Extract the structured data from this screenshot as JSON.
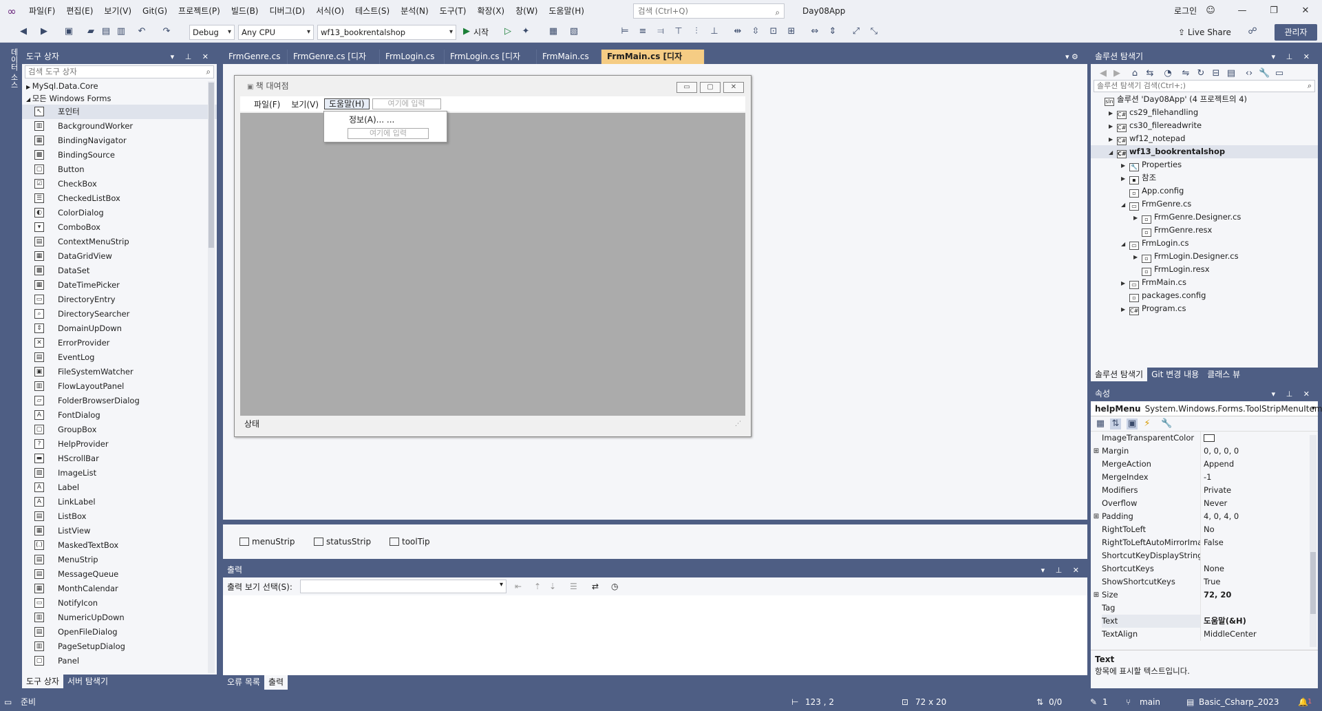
{
  "menubar": {
    "items": [
      "파일(F)",
      "편집(E)",
      "보기(V)",
      "Git(G)",
      "프로젝트(P)",
      "빌드(B)",
      "디버그(D)",
      "서식(O)",
      "테스트(S)",
      "분석(N)",
      "도구(T)",
      "확장(X)",
      "창(W)",
      "도움말(H)"
    ],
    "search_placeholder": "검색 (Ctrl+Q)",
    "solution_name": "Day08App",
    "login_label": "로그인"
  },
  "toolbar": {
    "config": "Debug",
    "platform": "Any CPU",
    "startup_project": "wf13_bookrentalshop",
    "start_label": "시작",
    "live_share": "Live Share",
    "admin_badge": "관리자"
  },
  "sidetab": {
    "label": "데이터 소스"
  },
  "toolbox": {
    "title": "도구 상자",
    "search_placeholder": "검색 도구 상자",
    "categories": [
      "MySql.Data.Core",
      "모든 Windows Forms"
    ],
    "items": [
      "포인터",
      "BackgroundWorker",
      "BindingNavigator",
      "BindingSource",
      "Button",
      "CheckBox",
      "CheckedListBox",
      "ColorDialog",
      "ComboBox",
      "ContextMenuStrip",
      "DataGridView",
      "DataSet",
      "DateTimePicker",
      "DirectoryEntry",
      "DirectorySearcher",
      "DomainUpDown",
      "ErrorProvider",
      "EventLog",
      "FileSystemWatcher",
      "FlowLayoutPanel",
      "FolderBrowserDialog",
      "FontDialog",
      "GroupBox",
      "HelpProvider",
      "HScrollBar",
      "ImageList",
      "Label",
      "LinkLabel",
      "ListBox",
      "ListView",
      "MaskedTextBox",
      "MenuStrip",
      "MessageQueue",
      "MonthCalendar",
      "NotifyIcon",
      "NumericUpDown",
      "OpenFileDialog",
      "PageSetupDialog",
      "Panel"
    ],
    "bottom_tabs": [
      "도구 상자",
      "서버 탐색기"
    ]
  },
  "editor_tabs": [
    {
      "label": "FrmGenre.cs",
      "active": false
    },
    {
      "label": "FrmGenre.cs [디자인]",
      "active": false
    },
    {
      "label": "FrmLogin.cs",
      "active": false
    },
    {
      "label": "FrmLogin.cs [디자인]",
      "active": false
    },
    {
      "label": "FrmMain.cs",
      "active": false
    },
    {
      "label": "FrmMain.cs [디자인]",
      "active": true
    }
  ],
  "designer": {
    "form_title": "책 대여점",
    "menu_items": [
      "파일(F)",
      "보기(V)",
      "도움말(H)"
    ],
    "type_here": "여기에 입력",
    "dropdown_item": "정보(A)... ...",
    "status_label": "상태",
    "tray": [
      "menuStrip",
      "statusStrip",
      "toolTip"
    ]
  },
  "output": {
    "title": "출력",
    "show_label": "출력 보기 선택(S):",
    "bottom_tabs": [
      "오류 목록",
      "출력"
    ]
  },
  "solution_explorer": {
    "title": "솔루션 탐색기",
    "search_placeholder": "솔루션 탐색기 검색(Ctrl+;)",
    "nodes": [
      {
        "label": "솔루션 'Day08App' (4 프로젝트의 4)",
        "indent": 0,
        "arrow": "",
        "icon": "sln"
      },
      {
        "label": "cs29_filehandling",
        "indent": 1,
        "arrow": "▶",
        "icon": "C#"
      },
      {
        "label": "cs30_filereadwrite",
        "indent": 1,
        "arrow": "▶",
        "icon": "C#"
      },
      {
        "label": "wf12_notepad",
        "indent": 1,
        "arrow": "▶",
        "icon": "C#"
      },
      {
        "label": "wf13_bookrentalshop",
        "indent": 1,
        "arrow": "◢",
        "icon": "C#",
        "selected": true
      },
      {
        "label": "Properties",
        "indent": 2,
        "arrow": "▶",
        "icon": "🔧"
      },
      {
        "label": "참조",
        "indent": 2,
        "arrow": "▶",
        "icon": "▪"
      },
      {
        "label": "App.config",
        "indent": 2,
        "arrow": "",
        "icon": "▫"
      },
      {
        "label": "FrmGenre.cs",
        "indent": 2,
        "arrow": "◢",
        "icon": "▭"
      },
      {
        "label": "FrmGenre.Designer.cs",
        "indent": 3,
        "arrow": "▶",
        "icon": "▫"
      },
      {
        "label": "FrmGenre.resx",
        "indent": 3,
        "arrow": "",
        "icon": "▫"
      },
      {
        "label": "FrmLogin.cs",
        "indent": 2,
        "arrow": "◢",
        "icon": "▭"
      },
      {
        "label": "FrmLogin.Designer.cs",
        "indent": 3,
        "arrow": "▶",
        "icon": "▫"
      },
      {
        "label": "FrmLogin.resx",
        "indent": 3,
        "arrow": "",
        "icon": "▫"
      },
      {
        "label": "FrmMain.cs",
        "indent": 2,
        "arrow": "▶",
        "icon": "▭"
      },
      {
        "label": "packages.config",
        "indent": 2,
        "arrow": "",
        "icon": "▫"
      },
      {
        "label": "Program.cs",
        "indent": 2,
        "arrow": "▶",
        "icon": "C#"
      }
    ],
    "bottom_tabs": [
      "솔루션 탐색기",
      "Git 변경 내용",
      "클래스 뷰"
    ]
  },
  "properties": {
    "title": "속성",
    "object_name": "helpMenu",
    "object_type": "System.Windows.Forms.ToolStripMenuItem",
    "rows": [
      {
        "name": "ImageTransparentColor",
        "value": "",
        "expand": false,
        "swatch": true
      },
      {
        "name": "Margin",
        "value": "0, 0, 0, 0",
        "expand": true
      },
      {
        "name": "MergeAction",
        "value": "Append",
        "expand": false
      },
      {
        "name": "MergeIndex",
        "value": "-1",
        "expand": false
      },
      {
        "name": "Modifiers",
        "value": "Private",
        "expand": false
      },
      {
        "name": "Overflow",
        "value": "Never",
        "expand": false
      },
      {
        "name": "Padding",
        "value": "4, 0, 4, 0",
        "expand": true
      },
      {
        "name": "RightToLeft",
        "value": "No",
        "expand": false
      },
      {
        "name": "RightToLeftAutoMirrorIma",
        "value": "False",
        "expand": false
      },
      {
        "name": "ShortcutKeyDisplayString",
        "value": "",
        "expand": false
      },
      {
        "name": "ShortcutKeys",
        "value": "None",
        "expand": false
      },
      {
        "name": "ShowShortcutKeys",
        "value": "True",
        "expand": false
      },
      {
        "name": "Size",
        "value": "72, 20",
        "expand": true,
        "bold": true
      },
      {
        "name": "Tag",
        "value": "",
        "expand": false
      },
      {
        "name": "Text",
        "value": "도움말(&H)",
        "expand": false,
        "bold": true,
        "selected": true
      },
      {
        "name": "TextAlign",
        "value": "MiddleCenter",
        "expand": false
      }
    ],
    "desc_title": "Text",
    "desc_text": "항목에 표시할 텍스트입니다."
  },
  "statusbar": {
    "ready": "준비",
    "position": "123 , 2",
    "size": "72 x 20",
    "sync": "0/0",
    "changes": "1",
    "branch": "main",
    "repo": "Basic_Csharp_2023",
    "notify": "1"
  }
}
